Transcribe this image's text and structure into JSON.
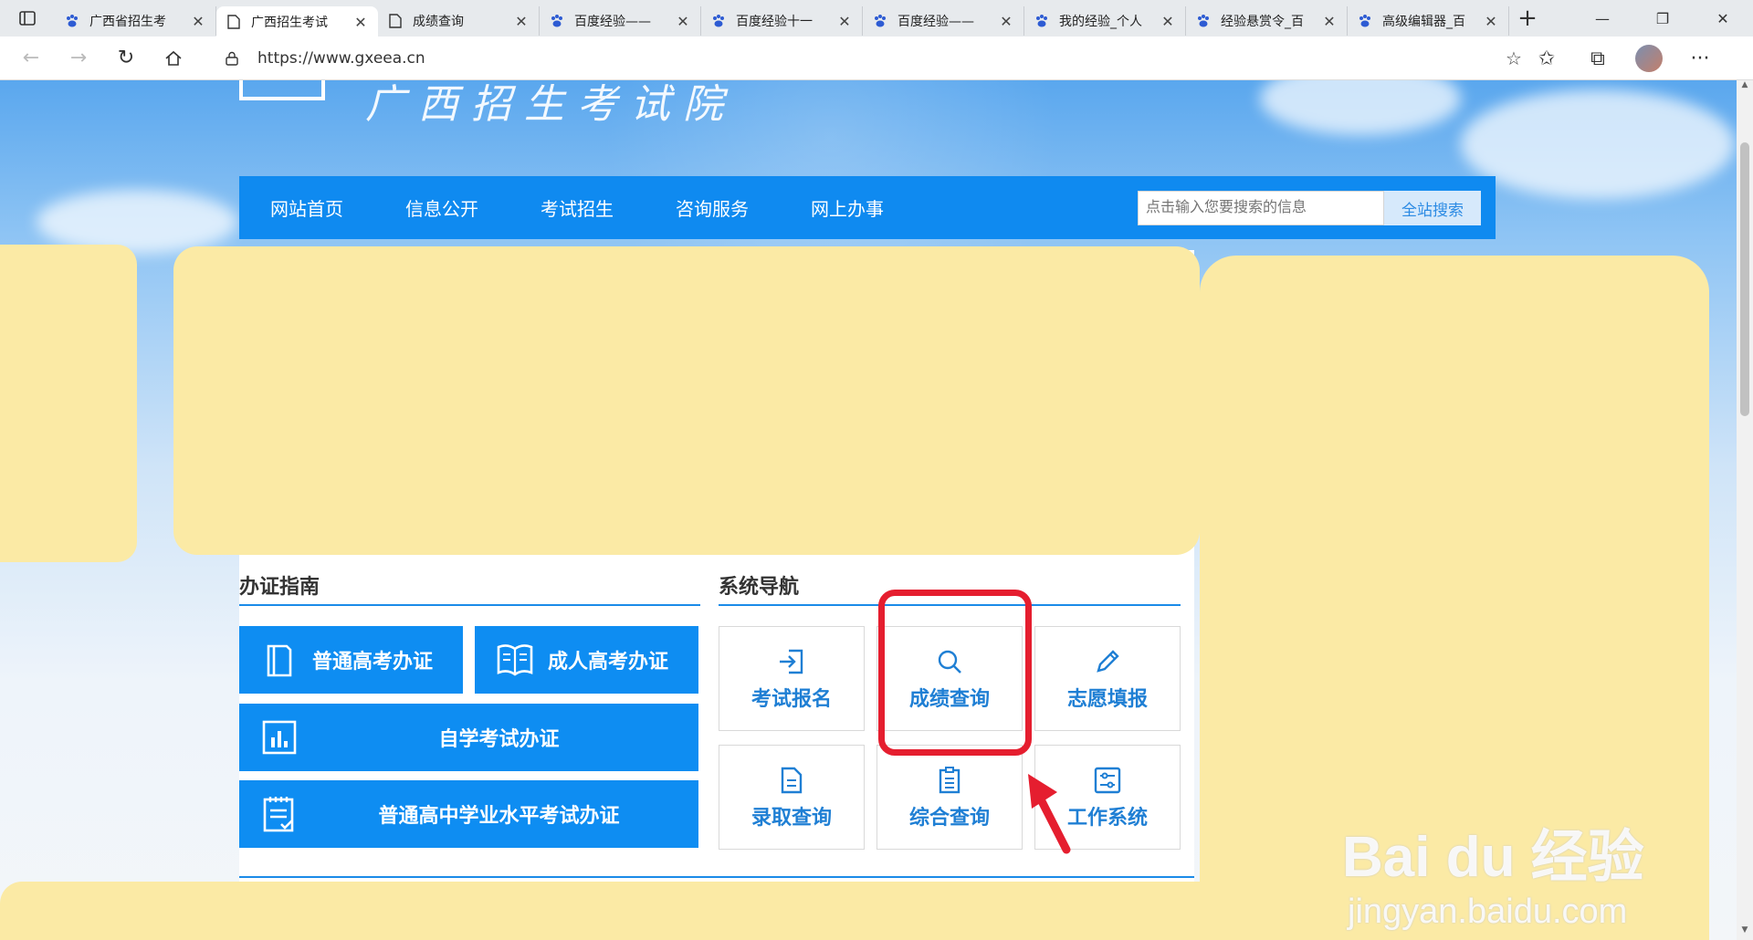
{
  "browser": {
    "tabs": [
      {
        "label": "广西省招生考",
        "icon": "baidu-paw-icon",
        "active": false
      },
      {
        "label": "广西招生考试",
        "icon": "page-icon",
        "active": true
      },
      {
        "label": "成绩查询",
        "icon": "page-icon",
        "active": false
      },
      {
        "label": "百度经验——",
        "icon": "baidu-paw-icon",
        "active": false
      },
      {
        "label": "百度经验十一",
        "icon": "baidu-paw-icon",
        "active": false
      },
      {
        "label": "百度经验——",
        "icon": "baidu-paw-icon",
        "active": false
      },
      {
        "label": "我的经验_个人",
        "icon": "baidu-paw-icon",
        "active": false
      },
      {
        "label": "经验悬赏令_百",
        "icon": "baidu-paw-icon",
        "active": false
      },
      {
        "label": "高级编辑器_百",
        "icon": "baidu-paw-icon",
        "active": false
      }
    ],
    "url": "https://www.gxeea.cn",
    "accent_color": "#0f8af0"
  },
  "site": {
    "logo_script": "广西招生考试院",
    "nav": [
      "网站首页",
      "信息公开",
      "考试招生",
      "咨询服务",
      "网上办事"
    ],
    "search_placeholder": "点击输入您要搜索的信息",
    "search_button": "全站搜索"
  },
  "guide": {
    "title": "办证指南",
    "buttons": [
      {
        "label": "普通高考办证",
        "icon": "book-icon"
      },
      {
        "label": "成人高考办证",
        "icon": "open-book-icon"
      },
      {
        "label": "自学考试办证",
        "icon": "chart-icon"
      },
      {
        "label": "普通高中学业水平考试办证",
        "icon": "clipboard-icon"
      }
    ]
  },
  "system_nav": {
    "title": "系统导航",
    "tiles": [
      {
        "label": "考试报名",
        "icon": "sign-in-icon"
      },
      {
        "label": "成绩查询",
        "icon": "search-icon",
        "highlighted": true
      },
      {
        "label": "志愿填报",
        "icon": "pencil-icon"
      },
      {
        "label": "录取查询",
        "icon": "document-icon"
      },
      {
        "label": "综合查询",
        "icon": "clipboard-list-icon"
      },
      {
        "label": "工作系统",
        "icon": "settings-sliders-icon"
      }
    ]
  },
  "watermark": {
    "top": "Bai du 经验",
    "bottom": "jingyan.baidu.com"
  },
  "annotation_color": "#e51e2f"
}
